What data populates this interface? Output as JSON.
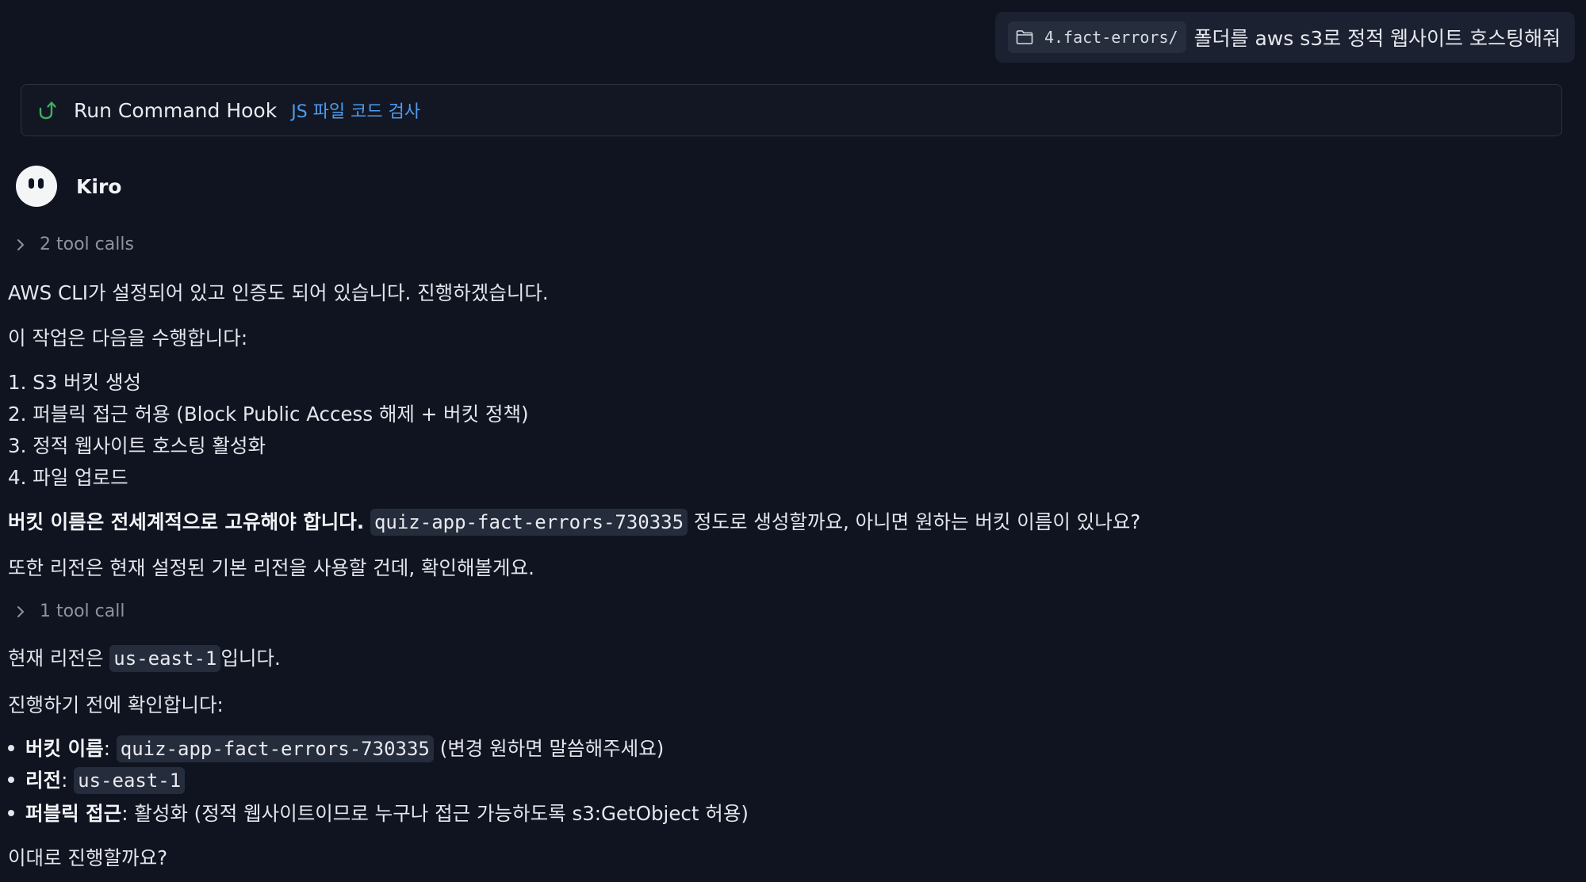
{
  "user_message": {
    "folder": "4.fact-errors/",
    "text": "폴더를 aws s3로 정적 웹사이트 호스팅해줘"
  },
  "hook": {
    "title": "Run Command Hook",
    "subtitle": "JS 파일 코드 검사"
  },
  "agent": {
    "name": "Kiro"
  },
  "tool_calls_1": "2 tool calls",
  "paragraph_1": "AWS CLI가 설정되어 있고 인증도 되어 있습니다. 진행하겠습니다.",
  "paragraph_2": "이 작업은 다음을 수행합니다:",
  "steps": [
    "1. S3 버킷 생성",
    "2. 퍼블릭 접근 허용 (Block Public Access 해제 + 버킷 정책)",
    "3. 정적 웹사이트 호스팅 활성화",
    "4. 파일 업로드"
  ],
  "bucket_note": {
    "bold": "버킷 이름은 전세계적으로 고유해야 합니다.",
    "code": "quiz-app-fact-errors-730335",
    "rest": "정도로 생성할까요, 아니면 원하는 버킷 이름이 있나요?"
  },
  "paragraph_3": "또한 리전은 현재 설정된 기본 리전을 사용할 건데, 확인해볼게요.",
  "tool_calls_2": "1 tool call",
  "region_line": {
    "prefix": "현재 리전은",
    "code": "us-east-1",
    "suffix": "입니다."
  },
  "paragraph_4": "진행하기 전에 확인합니다:",
  "confirm": {
    "bucket_label": "버킷 이름",
    "bucket_code": "quiz-app-fact-errors-730335",
    "bucket_note": "(변경 원하면 말씀해주세요)",
    "region_label": "리전",
    "region_code": "us-east-1",
    "public_label": "퍼블릭 접근",
    "public_text": ": 활성화 (정적 웹사이트이므로 누구나 접근 가능하도록 s3:GetObject 허용)"
  },
  "closing": "이대로 진행할까요?",
  "colors": {
    "background": "#0f1420",
    "accent_link": "#4e9cf0",
    "hook_icon": "#3fae5f",
    "code_bg": "#252c3b"
  },
  "icons": {
    "folder": "folder-icon",
    "hook": "hook-icon",
    "chevron": "chevron-right-icon"
  }
}
